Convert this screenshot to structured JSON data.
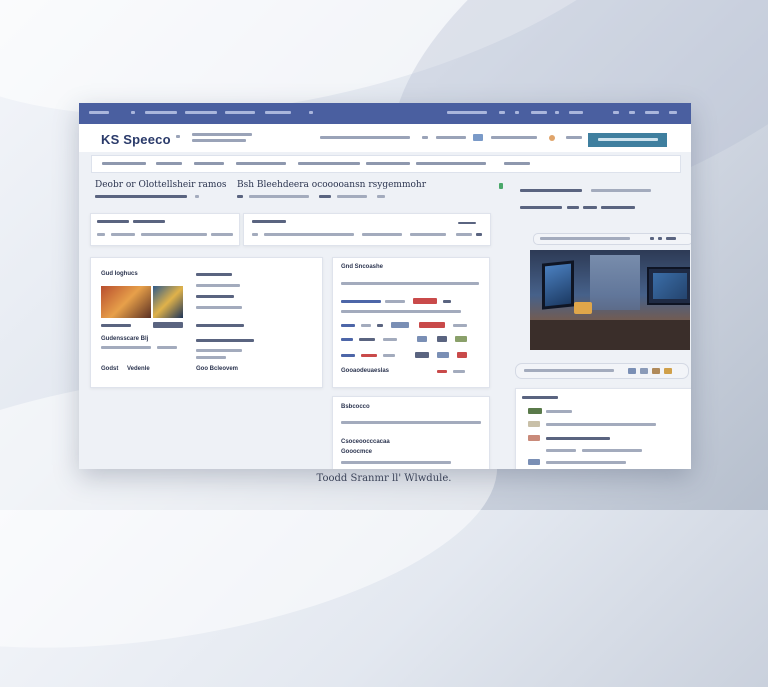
{
  "brand": {
    "logo_text": "KS Speeco"
  },
  "headline": {
    "left": "Deobr or Olottellsheir ramos",
    "right": "Bsh Bleehdeera ocooooansn rsygemmohr"
  },
  "cards": {
    "media_title": "Gud Ioghucs",
    "media_title2": "Gudensscare Blj",
    "media_foot_left": "Godst",
    "media_foot_right": "Vedenle",
    "media_foot_mid": "Goo Bcleovem",
    "table_title": "Gnd Sncoashe",
    "table_foot": "Gooaodeuaeslas",
    "lower_title": "Bsbcocco",
    "lower_sub": "Csoceoocccacaa",
    "lower_sub2": "Gooocmce"
  },
  "caption": "Toodd Sranmr ll' Wlwdule.",
  "colors": {
    "topbar": "#4a5fa0",
    "accent_button": "#3f7f9f",
    "accent_red": "#c94a4a",
    "accent_blue": "#4d66a8"
  },
  "icons": [
    "search-icon",
    "user-icon",
    "settings-icon",
    "menu-icon"
  ]
}
